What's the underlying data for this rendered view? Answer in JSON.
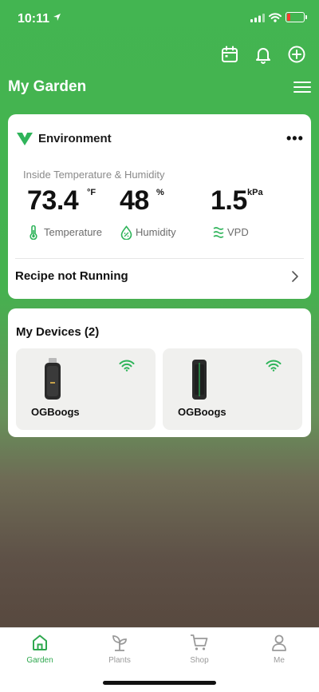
{
  "status_bar": {
    "time": "10:11"
  },
  "header": {
    "title": "My Garden",
    "icons": [
      "calendar-icon",
      "bell-icon",
      "plus-circle-icon",
      "hamburger-menu-icon"
    ]
  },
  "environment": {
    "title": "Environment",
    "more": "•••",
    "subtitle": "Inside Temperature & Humidity",
    "temperature": {
      "value": "73.4",
      "unit": "°F",
      "label": "Temperature"
    },
    "humidity": {
      "value": "48",
      "unit": "%",
      "label": "Humidity"
    },
    "vpd": {
      "value": "1.5",
      "unit": "kPa",
      "label": "VPD"
    },
    "recipe": "Recipe not Running"
  },
  "devices": {
    "title": "My Devices (2)",
    "items": [
      {
        "name": "OGBoogs",
        "status": "wifi-connected"
      },
      {
        "name": "OGBoogs",
        "status": "wifi-connected"
      }
    ]
  },
  "tabbar": {
    "garden": "Garden",
    "plants": "Plants",
    "shop": "Shop",
    "me": "Me",
    "active_color": "#2fa84f",
    "inactive_color": "#9a9a9a"
  },
  "colors": {
    "brand_green": "#43b551",
    "wifi_green": "#2fb45a"
  }
}
